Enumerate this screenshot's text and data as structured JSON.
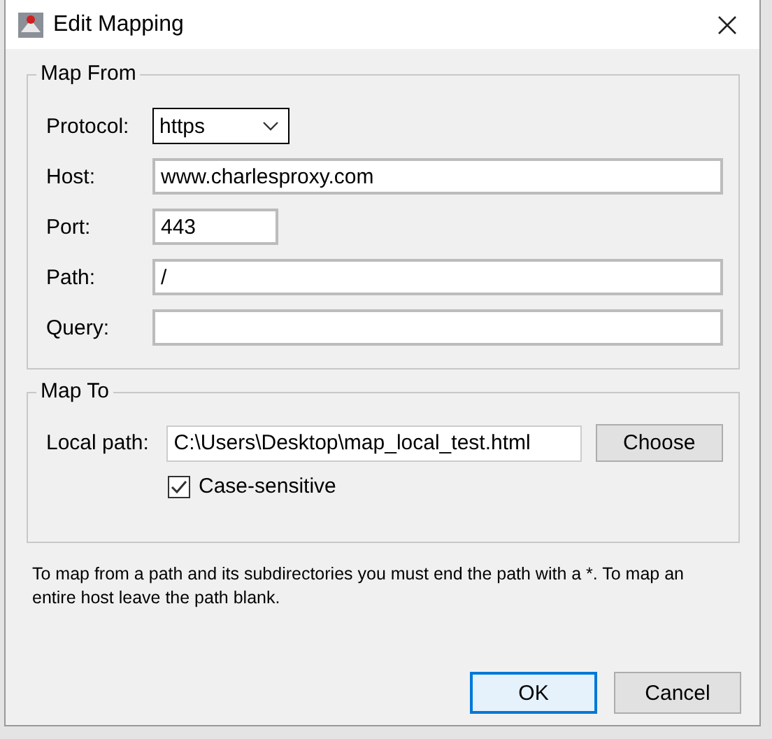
{
  "window": {
    "title": "Edit Mapping"
  },
  "map_from": {
    "title": "Map From",
    "protocol": {
      "label": "Protocol:",
      "value": "https"
    },
    "fields": [
      {
        "label": "Host:",
        "value": "www.charlesproxy.com",
        "kind": "wide"
      },
      {
        "label": "Port:",
        "value": "443",
        "kind": "short"
      },
      {
        "label": "Path:",
        "value": "/",
        "kind": "wide"
      },
      {
        "label": "Query:",
        "kind": "wide"
      }
    ]
  },
  "map_to": {
    "title": "Map To",
    "local_path": {
      "label": "Local path:",
      "value": "C:\\Users\\Desktop\\map_local_test.html"
    },
    "choose_button": "Choose",
    "case_sensitive": {
      "label": "Case-sensitive",
      "checked": true
    }
  },
  "note": "To map from a path and its subdirectories you must end the path with a *. To map an entire host leave the path blank.",
  "buttons": [
    {
      "label": "OK",
      "selected": true
    },
    {
      "label": "Cancel",
      "selected": false
    }
  ]
}
